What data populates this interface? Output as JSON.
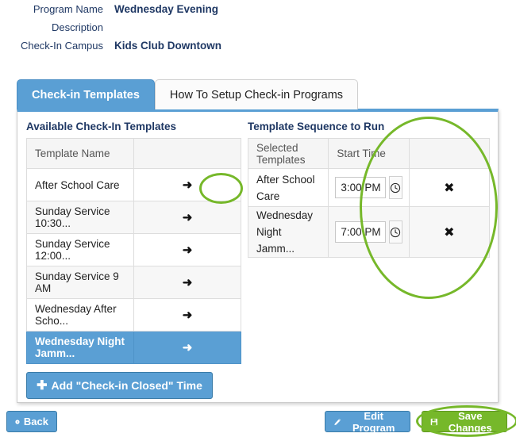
{
  "header": {
    "rows": [
      {
        "label": "Program Name",
        "value": "Wednesday Evening"
      },
      {
        "label": "Description",
        "value": ""
      },
      {
        "label": "Check-In Campus",
        "value": "Kids Club Downtown"
      }
    ]
  },
  "tabs": [
    {
      "label": "Check-in Templates",
      "active": true
    },
    {
      "label": "How To Setup Check-in Programs",
      "active": false
    }
  ],
  "left_panel": {
    "title": "Available Check-In Templates",
    "column_header": "Template Name",
    "rows": [
      {
        "name": "After School Care",
        "arrow_icon": "arrow-right-icon",
        "selected": false
      },
      {
        "name": "Sunday Service 10:30...",
        "arrow_icon": "arrow-right-icon",
        "selected": false
      },
      {
        "name": "Sunday Service 12:00...",
        "arrow_icon": "arrow-right-icon",
        "selected": false
      },
      {
        "name": "Sunday Service 9 AM",
        "arrow_icon": "arrow-right-icon",
        "selected": false
      },
      {
        "name": "Wednesday After Scho...",
        "arrow_icon": "arrow-right-icon",
        "selected": false
      },
      {
        "name": "Wednesday Night Jamm...",
        "arrow_icon": "arrow-right-icon",
        "selected": true
      }
    ],
    "add_button": {
      "label": "Add \"Check-in Closed\" Time",
      "icon": "plus-icon"
    }
  },
  "right_panel": {
    "title": "Template Sequence to Run",
    "column_headers": [
      "Selected Templates",
      "Start Time",
      ""
    ],
    "rows": [
      {
        "name": "After School Care",
        "start_time": "3:00 PM",
        "clock_icon": "clock-icon",
        "remove_icon": "close-x-icon"
      },
      {
        "name": "Wednesday Night Jamm...",
        "start_time": "7:00 PM",
        "clock_icon": "clock-icon",
        "remove_icon": "close-x-icon"
      }
    ]
  },
  "footer": {
    "back": {
      "label": "Back",
      "icon": "back-circle-arrow-icon"
    },
    "edit_program": {
      "label": "Edit Program",
      "icon": "pencil-icon"
    },
    "save_changes": {
      "label": "Save Changes",
      "icon": "save-floppy-icon"
    }
  },
  "annotations": {
    "color": "#76b82a",
    "shapes": [
      "arrow-button-highlight",
      "start-time-column-highlight",
      "save-changes-highlight"
    ]
  },
  "colors": {
    "primary_blue": "#5a9fd4",
    "header_navy": "#1f3864",
    "accent_green": "#76b82a",
    "row_alt": "#f7f7f7"
  }
}
